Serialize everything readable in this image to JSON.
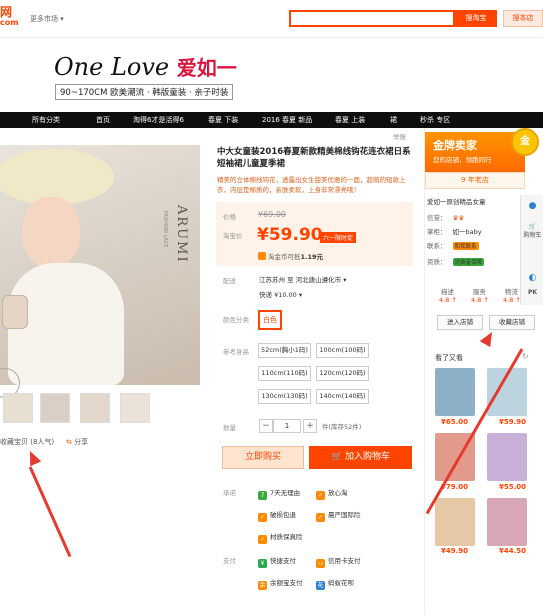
{
  "header": {
    "logo_main": "网",
    "logo_sub": "com",
    "market": "更多市场",
    "search_button": "搜淘宝",
    "store_button": "搜本店"
  },
  "banner": {
    "brand_en": "One Love",
    "brand_cn": "爱如一",
    "tagline": "90~170CM 欧美潮流 · 韩版童装 · 亲子时装"
  },
  "nav": [
    "所有分类",
    "首页",
    "淘得6才是活得6",
    "春夏 下装",
    "2016 春夏 新品",
    "春夏 上装",
    "裙",
    "秒杀 专区"
  ],
  "gallery": {
    "vertical_big": "ARUMI",
    "vertical_small": "FASHION LACE",
    "collect": "收藏宝贝 (8人气)",
    "share": "分享"
  },
  "product": {
    "report": "举报",
    "title": "中大女童装2016春夏新款精美棉线钩花连衣裙日系短袖裙儿童夏季裙",
    "desc": "精美的立体棉线钩花，透露出女生甜美优雅的一面，超萌的短款上衣，内层是棉质的，亲肤柔软，上身非常漂亮哦！",
    "price_label": "价格",
    "price_orig": "¥69.00",
    "promo_label": "淘宝价",
    "price": "¥59.90",
    "price_tag": "六一限时促",
    "coin": "淘金币可抵",
    "coin_value": "1.19元",
    "ship_label": "配送",
    "ship_from": "江苏苏州 至 河北唐山遵化市 ▾",
    "ship_fee": "快递 ¥10.00 ▾",
    "color_label": "颜色分类",
    "color_value": "白色",
    "size_label": "参考身高",
    "sizes": [
      "52cm(胸小1码)",
      "100cm(100码)",
      "110cm(110码)",
      "120cm(120码)",
      "130cm(130码)",
      "140cm(140码)"
    ],
    "qty_label": "数量",
    "qty_minus": "−",
    "qty_value": "1",
    "qty_plus": "+",
    "stock": "件(库存52件)",
    "buy_button": "立即购买",
    "cart_button": "加入购物车",
    "promise_label": "承诺",
    "promises": [
      "7天无理由",
      "放心淘",
      "破损包退",
      "晨严国际险",
      "材质保真险"
    ],
    "pay_label": "支付",
    "payments": [
      "快捷支付",
      "信用卡支付",
      "余额宝支付",
      "蚂蚁花呗"
    ]
  },
  "shop": {
    "gold_title": "金牌卖家",
    "gold_sub": "您的店铺，领跑同行",
    "medal": "金",
    "years": "9 年老店",
    "name": "爱如一原创精品女童",
    "credit_label": "信誉：",
    "keeper_label": "掌柜：",
    "keeper": "如一baby",
    "contact_label": "联系：",
    "contact_badge": "和我联系",
    "qual_label": "资质：",
    "qual_badge": "消费者保障",
    "dsr_heads": [
      "描述",
      "服务",
      "物流"
    ],
    "dsr_vals": [
      "4.8 ↑",
      "4.8 ↑",
      "4.8 ↑"
    ],
    "enter_button": "进入店铺",
    "fav_button": "收藏店铺",
    "seen_head": "看了又看",
    "refresh": "↻",
    "recs": [
      "¥65.00",
      "¥59.90",
      "¥79.00",
      "¥55.00",
      "¥49.90",
      "¥44.50"
    ]
  },
  "rail": {
    "cart": "购物车",
    "pk": "PK"
  },
  "colors": {
    "accent": "#ff4400",
    "nav": "#0e0e0e",
    "annotation_arrow": "#e53b2f"
  }
}
